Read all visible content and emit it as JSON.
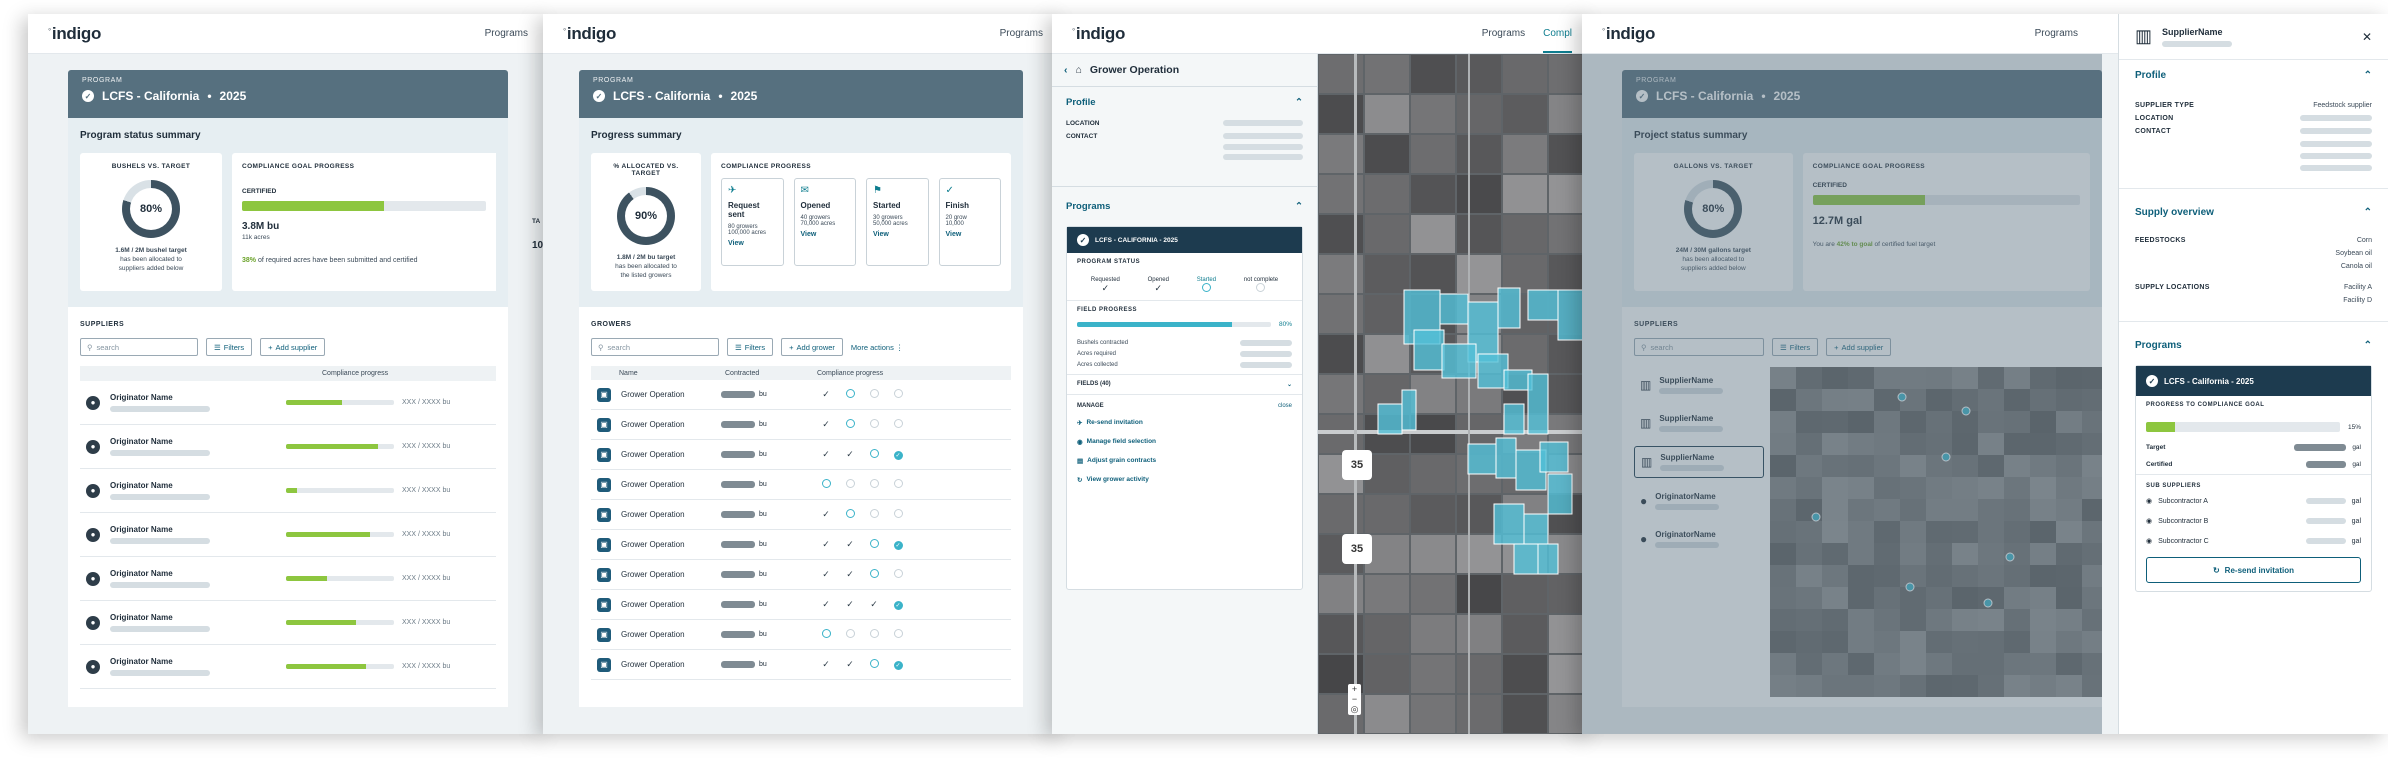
{
  "brand": {
    "logo": "indigo"
  },
  "nav": {
    "programs": "Programs",
    "compliance": "Compl"
  },
  "p1": {
    "program_caption": "PROGRAM",
    "program_title": "LCFS - California",
    "program_year": "2025",
    "summary_title": "Program status summary",
    "bushels_caption": "BUSHELS VS. TARGET",
    "donut_pct": "80%",
    "bushels_line1": "1.6M / 2M bushel target",
    "bushels_line2": "has been allocated to",
    "bushels_line3": "suppliers added below",
    "goal_caption": "COMPLIANCE GOAL PROGRESS",
    "certified_label": "CERTIFIED",
    "certified_value": "3.8M bu",
    "certified_sub": "11k acres",
    "certified_fill": 0.58,
    "goal_note_pct": "38%",
    "goal_note_text": " of required acres have been submitted and certified",
    "target_label": "TA",
    "target_value": "10",
    "suppliers_label": "SUPPLIERS",
    "search_placeholder": "search",
    "filters": "Filters",
    "add_supplier": "Add supplier",
    "col_compliance": "Compliance progress",
    "row_name": "Originator Name",
    "row_amount": "XXX / XXXX bu",
    "rows": [
      {
        "fill": 0.52
      },
      {
        "fill": 0.85
      },
      {
        "fill": 0.1
      },
      {
        "fill": 0.78
      },
      {
        "fill": 0.38
      },
      {
        "fill": 0.65
      },
      {
        "fill": 0.74
      }
    ]
  },
  "p2": {
    "program_caption": "PROGRAM",
    "program_title": "LCFS - California",
    "program_year": "2025",
    "summary_title": "Progress summary",
    "alloc_caption": "% ALLOCATED VS. TARGET",
    "donut_pct": "90%",
    "alloc_line1": "1.8M / 2M bu target",
    "alloc_line2": "has been allocated to",
    "alloc_line3": "the listed growers",
    "compliance_caption": "COMPLIANCE PROGRESS",
    "steps": [
      {
        "title": "Request sent",
        "a": "80 growers",
        "b": "100,000 acres",
        "view": "View"
      },
      {
        "title": "Opened",
        "a": "40 growers",
        "b": "70,000 acres",
        "view": "View"
      },
      {
        "title": "Started",
        "a": "30 growers",
        "b": "50,000 acres",
        "view": "View"
      },
      {
        "title": "Finish",
        "a": "20 grow",
        "b": "10,000",
        "view": "View"
      }
    ],
    "growers_label": "GROWERS",
    "search_placeholder": "search",
    "filters": "Filters",
    "add_grower": "Add grower",
    "more_actions": "More actions",
    "col_name": "Name",
    "col_contracted": "Contracted",
    "col_compliance": "Compliance progress",
    "row_name": "Grower Operation",
    "unit": "bu"
  },
  "p3": {
    "title": "Grower Operation",
    "profile": "Profile",
    "location_label": "LOCATION",
    "contact_label": "CONTACT",
    "programs": "Programs",
    "program_card_title": "LCFS - CALIFORNIA - 2025",
    "program_status": "PROGRAM STATUS",
    "status_requested": "Requested",
    "status_opened": "Opened",
    "status_started": "Started",
    "status_not_complete": "not complete",
    "field_progress": "FIELD PROGRESS",
    "field_pct": "80%",
    "field_fill": 0.8,
    "bushels_contracted": "Bushels contracted",
    "acres_required": "Acres required",
    "acres_collected": "Acres collected",
    "fields": "FIELDS (40)",
    "manage": "MANAGE",
    "close": "close",
    "actions": [
      "Re-send invitation",
      "Manage field selection",
      "Adjust grain contracts",
      "View grower activity"
    ],
    "highway": "35"
  },
  "p4": {
    "program_caption": "PROGRAM",
    "program_title": "LCFS - California",
    "program_year": "2025",
    "summary_title": "Project status summary",
    "gallons_caption": "GALLONS VS. TARGET",
    "donut_pct": "80%",
    "gallons_line1": "24M / 30M gallons target",
    "gallons_line2": "has been allocated to",
    "gallons_line3": "suppliers added below",
    "goal_caption": "COMPLIANCE GOAL PROGRESS",
    "certified_label": "CERTIFIED",
    "certified_value": "12.7M gal",
    "certified_note_pre": "You are ",
    "certified_note_pct": "42% to goal",
    "certified_note_post": " of certified fuel target",
    "certified_fill": 0.42,
    "suppliers_label": "SUPPLIERS",
    "search_placeholder": "search",
    "filters": "Filters",
    "add_supplier": "Add supplier",
    "list": [
      "SupplierName",
      "SupplierName",
      "SupplierName",
      "OriginatorName",
      "OriginatorName"
    ]
  },
  "side": {
    "name": "SupplierName",
    "profile": "Profile",
    "supplier_type_label": "SUPPLIER TYPE",
    "supplier_type_value": "Feedstock supplier",
    "location_label": "LOCATION",
    "contact_label": "CONTACT",
    "supply_overview": "Supply overview",
    "feedstocks_label": "FEEDSTOCKS",
    "feedstocks": [
      "Corn",
      "Soybean oil",
      "Canola oil"
    ],
    "supply_locations_label": "SUPPLY LOCATIONS",
    "supply_locations": [
      "Facility A",
      "Facility D"
    ],
    "programs": "Programs",
    "program_title": "LCFS - California - 2025",
    "progress_caption": "PROGRESS TO COMPLIANCE GOAL",
    "progress_pct": "15%",
    "progress_fill": 0.15,
    "target_label": "Target",
    "certified_label": "Certified",
    "unit": "gal",
    "sub_suppliers_label": "SUB SUPPLIERS",
    "sub_suppliers": [
      "Subcontractor A",
      "Subcontractor B",
      "Subcontractor C"
    ],
    "resend": "Re-send invitation"
  },
  "colors": {
    "accent": "#0e7d8f",
    "header": "#56707f",
    "progress": "#8dc63f",
    "field": "#53c1d8"
  }
}
